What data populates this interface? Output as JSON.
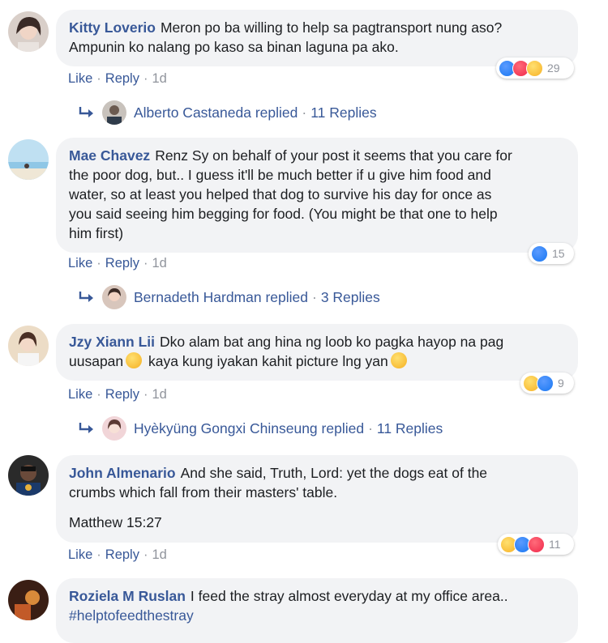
{
  "comments": [
    {
      "author": "Kitty Loverio",
      "text_line1": "Meron po ba willing to help sa pagtransport nung aso?",
      "text_line2": "Ampunin ko nalang po kaso sa binan laguna pa ako.",
      "like": "Like",
      "reply": "Reply",
      "time": "1d",
      "reaction_icons": [
        "like-icon",
        "love-icon",
        "wow-icon"
      ],
      "reaction_count": "29",
      "replied_by": "Alberto Castaneda replied",
      "replies_count": "11 Replies"
    },
    {
      "author": "Mae Chavez",
      "text_line1": "Renz Sy on behalf of your post it seems that you care for",
      "text_line2": "the poor dog, but.. I guess it'll be much better if u give him food and",
      "text_line3": "water, so at least you helped that dog to survive his day for once as",
      "text_line4": "you said seeing him begging for food. (You might be that one to help",
      "text_line5": "him first)",
      "like": "Like",
      "reply": "Reply",
      "time": "1d",
      "reaction_icons": [
        "like-icon"
      ],
      "reaction_count": "15",
      "replied_by": "Bernadeth Hardman replied",
      "replies_count": "3 Replies"
    },
    {
      "author": "Jzy Xiann Lii",
      "text_line1": "Dko alam bat ang hina ng loob ko pagka hayop na pag",
      "text_line2a": "uusapan",
      "text_line2b": " kaya kung iyakan kahit picture lng yan",
      "like": "Like",
      "reply": "Reply",
      "time": "1d",
      "reaction_icons": [
        "sad-icon",
        "like-icon"
      ],
      "reaction_count": "9",
      "replied_by": "Hyèkyüng Gongxi Chinseung replied",
      "replies_count": "11 Replies"
    },
    {
      "author": "John Almenario",
      "text_line1": "And she said, Truth, Lord: yet the dogs eat of the",
      "text_line2": "crumbs which fall from their masters' table.",
      "text_line3": "Matthew 15:27",
      "like": "Like",
      "reply": "Reply",
      "time": "1d",
      "reaction_icons": [
        "sad-icon",
        "like-icon",
        "love-icon"
      ],
      "reaction_count": "11"
    },
    {
      "author": "Roziela M Ruslan",
      "text_line1": "I feed the stray almost everyday at my office area..",
      "hashtag": "#helptofeedthestray"
    }
  ],
  "separator": "·"
}
